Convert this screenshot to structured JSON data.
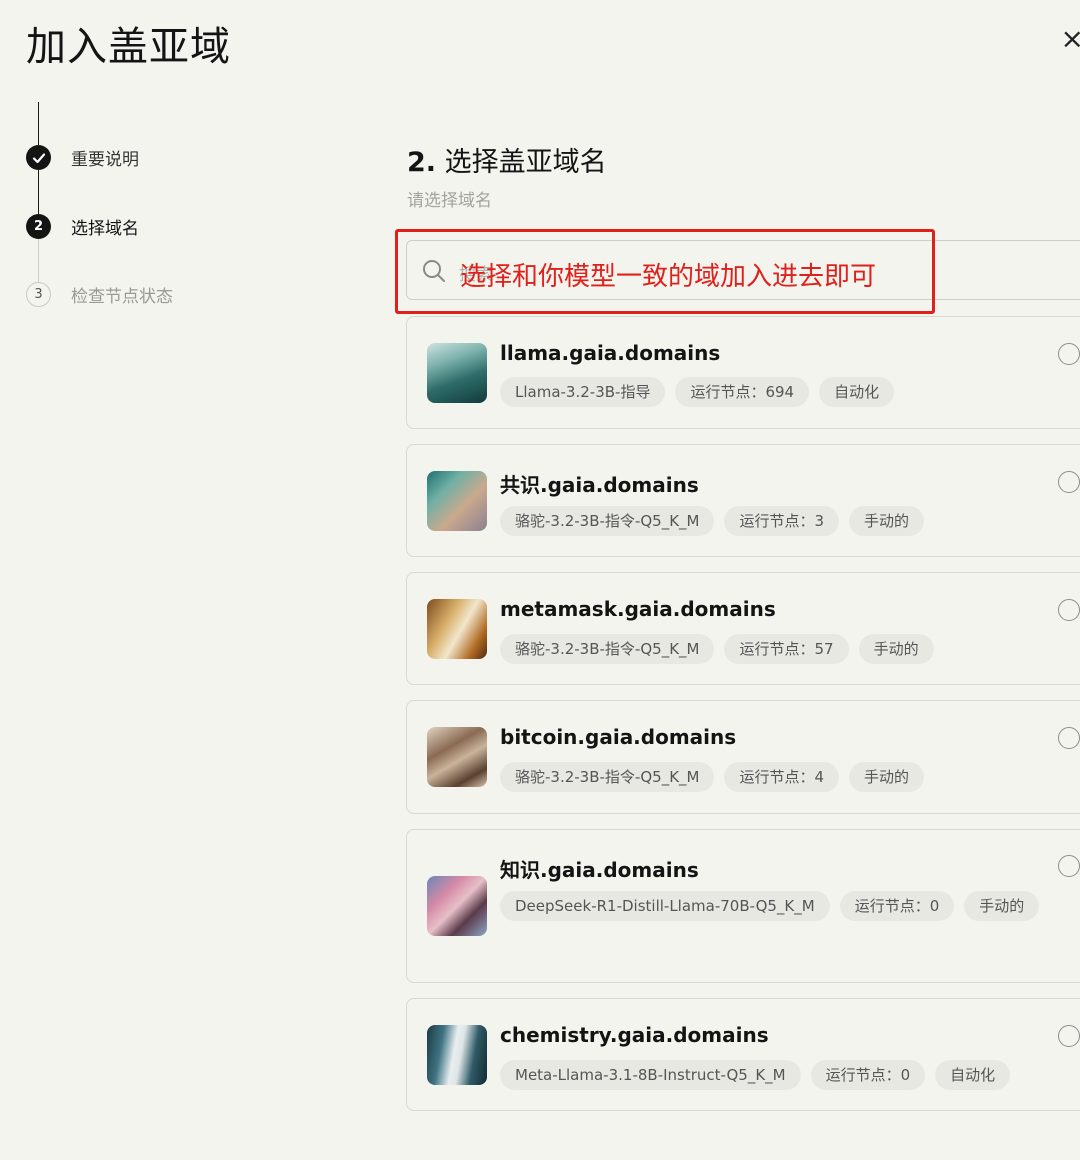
{
  "page": {
    "title": "加入盖亚域",
    "close_glyph": "×"
  },
  "steps": [
    {
      "num": "",
      "label": "重要说明",
      "state": "done"
    },
    {
      "num": "2",
      "label": "选择域名",
      "state": "active"
    },
    {
      "num": "3",
      "label": "检查节点状态",
      "state": "pending"
    }
  ],
  "section": {
    "title_num": "2.",
    "title_text": " 选择盖亚域名",
    "subtitle": "请选择域名"
  },
  "search": {
    "placeholder": "搜索",
    "annotation": "选择和你模型一致的域加入进去即可"
  },
  "domains": [
    {
      "name": "llama.gaia.domains",
      "tags": [
        "Llama-3.2-3B-指导",
        "运行节点：694",
        "自动化"
      ]
    },
    {
      "name": "共识.gaia.domains",
      "tags": [
        "骆驼-3.2-3B-指令-Q5_K_M",
        "运行节点：3",
        "手动的"
      ]
    },
    {
      "name": "metamask.gaia.domains",
      "tags": [
        "骆驼-3.2-3B-指令-Q5_K_M",
        "运行节点：57",
        "手动的"
      ]
    },
    {
      "name": "bitcoin.gaia.domains",
      "tags": [
        "骆驼-3.2-3B-指令-Q5_K_M",
        "运行节点：4",
        "手动的"
      ]
    },
    {
      "name": "知识.gaia.domains",
      "tags": [
        "DeepSeek-R1-Distill-Llama-70B-Q5_K_M",
        "运行节点：0",
        "手动的"
      ]
    },
    {
      "name": "chemistry.gaia.domains",
      "tags": [
        "Meta-Llama-3.1-8B-Instruct-Q5_K_M",
        "运行节点：0",
        "自动化"
      ]
    }
  ],
  "colors": {
    "background": "#f4f4ef",
    "annotation": "#e0201b",
    "tag_bg": "#e8e8e3"
  }
}
